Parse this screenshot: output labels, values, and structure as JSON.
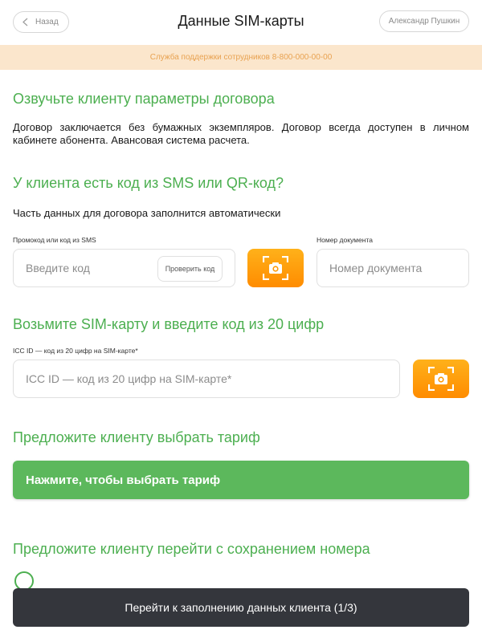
{
  "header": {
    "back_label": "Назад",
    "title": "Данные SIM-карты",
    "user_name": "Александр Пушкин"
  },
  "banner": {
    "text": "Служба поддержки сотрудников 8-800-000-00-00"
  },
  "section_contract": {
    "heading": "Озвучьте клиенту параметры договора",
    "text": "Договор заключается без бумажных экземпляров. Договор всегда доступен в личном кабинете абонента. Авансовая система расчета."
  },
  "section_code": {
    "heading": "У клиента есть код из SMS или QR-код?",
    "text": "Часть данных для договора заполнится автоматически",
    "promo_label": "Промокод или код из SMS",
    "promo_placeholder": "Введите код",
    "check_button": "Проверить код",
    "doc_label": "Номер документа",
    "doc_placeholder": "Номер документа"
  },
  "section_sim": {
    "heading": "Возьмите SIM-карту и введите код из 20 цифр",
    "iccid_label": "ICC ID — код из 20 цифр на SIM-карте*",
    "iccid_placeholder": "ICC ID — код из 20 цифр на SIM-карте*"
  },
  "section_tariff": {
    "heading": "Предложите клиенту выбрать тариф",
    "button": "Нажмите, чтобы выбрать тариф"
  },
  "section_number": {
    "heading": "Предложите клиенту перейти с сохранением номера"
  },
  "footer": {
    "next_button": "Перейти к заполнению данных клиента (1/3)"
  },
  "icons": {
    "back": "chevron-left-icon",
    "scan": "camera-scan-icon"
  },
  "colors": {
    "accent_green": "#4caf50",
    "button_green": "#5cb85c",
    "banner_bg": "#fbe6cc",
    "banner_text": "#e8a251",
    "scan_orange": "#ff9800",
    "footer_button": "#34363c"
  }
}
